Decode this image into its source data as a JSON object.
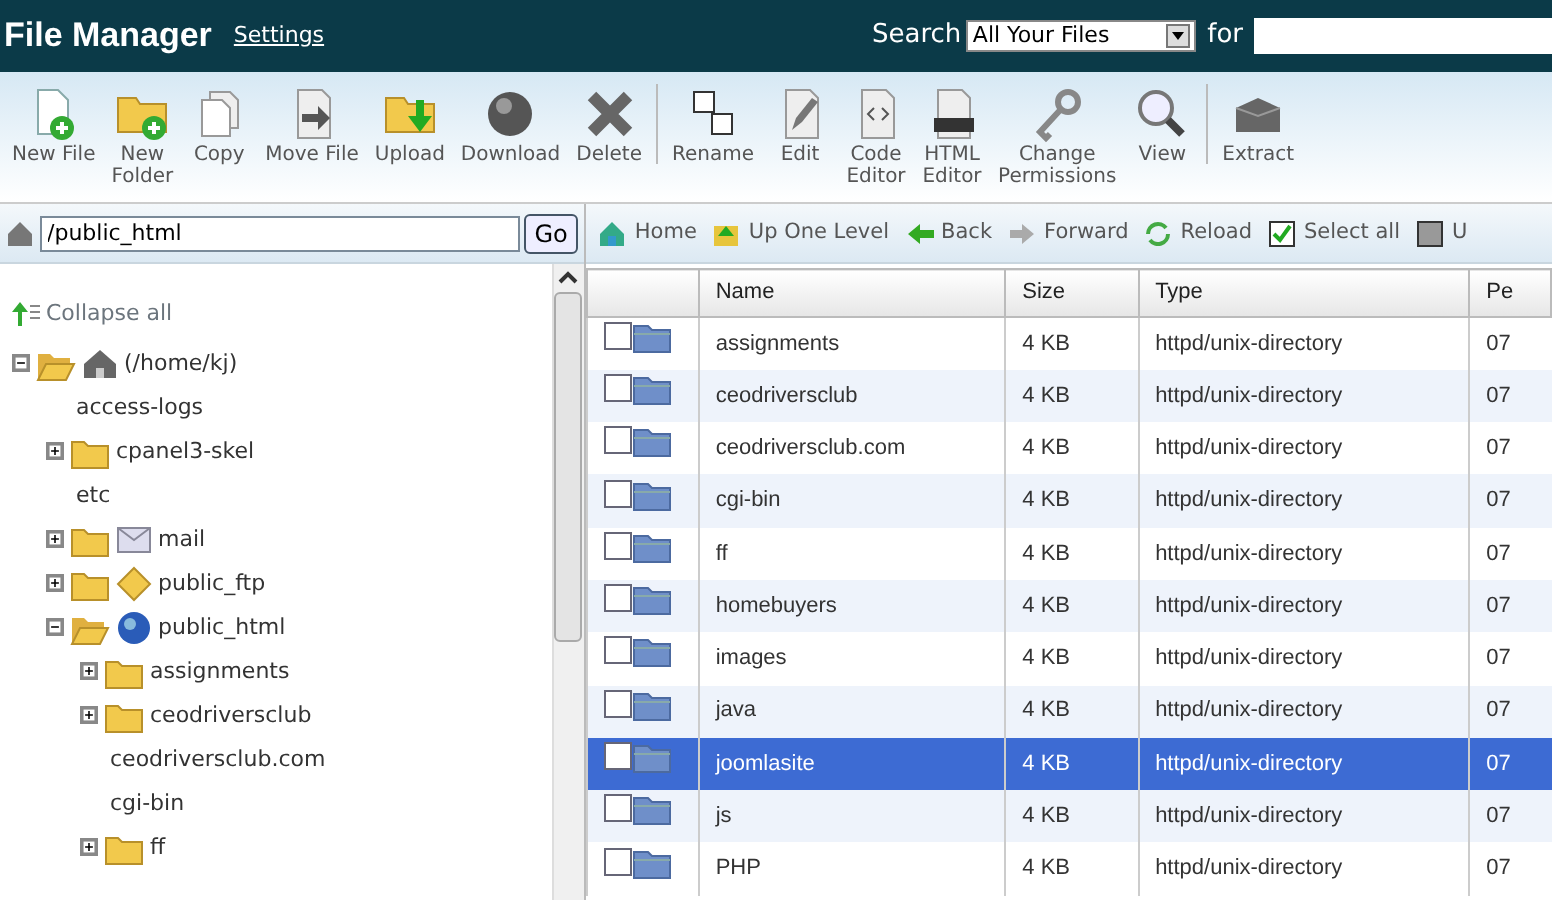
{
  "header": {
    "title": "File Manager",
    "settings_link": "Settings",
    "search_label": "Search",
    "search_scope": "All Your Files",
    "for_label": "for"
  },
  "toolbar": [
    [
      {
        "kind": "new-file",
        "lines": [
          "New File"
        ]
      },
      {
        "kind": "new-folder",
        "lines": [
          "New",
          "Folder"
        ]
      },
      {
        "kind": "copy",
        "lines": [
          "Copy"
        ]
      },
      {
        "kind": "move",
        "lines": [
          "Move File"
        ]
      },
      {
        "kind": "upload",
        "lines": [
          "Upload"
        ]
      },
      {
        "kind": "download",
        "lines": [
          "Download"
        ]
      },
      {
        "kind": "delete",
        "lines": [
          "Delete"
        ]
      }
    ],
    [
      {
        "kind": "rename",
        "lines": [
          "Rename"
        ]
      },
      {
        "kind": "edit",
        "lines": [
          "Edit"
        ]
      },
      {
        "kind": "code",
        "lines": [
          "Code",
          "Editor"
        ]
      },
      {
        "kind": "html",
        "lines": [
          "HTML",
          "Editor"
        ]
      },
      {
        "kind": "permissions",
        "lines": [
          "Change",
          "Permissions"
        ]
      },
      {
        "kind": "view",
        "lines": [
          "View"
        ]
      }
    ],
    [
      {
        "kind": "extract",
        "lines": [
          "Extract"
        ]
      }
    ]
  ],
  "path": {
    "value": "/public_html",
    "button": "Go"
  },
  "tree": {
    "collapse_all": "Collapse all",
    "items": [
      {
        "label": "(/home/kj)",
        "kind": "home",
        "expanded": true,
        "children": [
          {
            "label": "access-logs",
            "kind": "plain"
          },
          {
            "label": "cpanel3-skel",
            "kind": "folder",
            "expanded": false
          },
          {
            "label": "etc",
            "kind": "plain"
          },
          {
            "label": "mail",
            "kind": "mail",
            "expanded": false
          },
          {
            "label": "public_ftp",
            "kind": "ftp",
            "expanded": false
          },
          {
            "label": "public_html",
            "kind": "web",
            "expanded": true,
            "children": [
              {
                "label": "assignments",
                "kind": "folder",
                "expanded": false
              },
              {
                "label": "ceodriversclub",
                "kind": "folder",
                "expanded": false
              },
              {
                "label": "ceodriversclub.com",
                "kind": "plain"
              },
              {
                "label": "cgi-bin",
                "kind": "plain"
              },
              {
                "label": "ff",
                "kind": "folder",
                "expanded": false
              }
            ]
          }
        ]
      }
    ]
  },
  "nav": [
    {
      "kind": "home",
      "label": "Home"
    },
    {
      "kind": "up",
      "label": "Up One Level"
    },
    {
      "kind": "back",
      "label": "Back"
    },
    {
      "kind": "forward",
      "label": "Forward"
    },
    {
      "kind": "reload",
      "label": "Reload"
    },
    {
      "kind": "select",
      "label": "Select all"
    },
    {
      "kind": "unselect",
      "label": "U"
    }
  ],
  "table": {
    "columns": [
      "Name",
      "Size",
      "Type",
      "Pe"
    ],
    "rows": [
      {
        "name": "assignments",
        "size": "4 KB",
        "type": "httpd/unix-directory",
        "column_4": "07",
        "checked": false,
        "selected": false
      },
      {
        "name": "ceodriversclub",
        "size": "4 KB",
        "type": "httpd/unix-directory",
        "column_4": "07",
        "checked": false,
        "selected": false
      },
      {
        "name": "ceodriversclub.com",
        "size": "4 KB",
        "type": "httpd/unix-directory",
        "column_4": "07",
        "checked": false,
        "selected": false
      },
      {
        "name": "cgi-bin",
        "size": "4 KB",
        "type": "httpd/unix-directory",
        "column_4": "07",
        "checked": false,
        "selected": false
      },
      {
        "name": "ff",
        "size": "4 KB",
        "type": "httpd/unix-directory",
        "column_4": "07",
        "checked": false,
        "selected": false
      },
      {
        "name": "homebuyers",
        "size": "4 KB",
        "type": "httpd/unix-directory",
        "column_4": "07",
        "checked": false,
        "selected": false
      },
      {
        "name": "images",
        "size": "4 KB",
        "type": "httpd/unix-directory",
        "column_4": "07",
        "checked": false,
        "selected": false
      },
      {
        "name": "java",
        "size": "4 KB",
        "type": "httpd/unix-directory",
        "column_4": "07",
        "checked": false,
        "selected": false
      },
      {
        "name": "joomlasite",
        "size": "4 KB",
        "type": "httpd/unix-directory",
        "column_4": "07",
        "checked": false,
        "selected": true
      },
      {
        "name": "js",
        "size": "4 KB",
        "type": "httpd/unix-directory",
        "column_4": "07",
        "checked": false,
        "selected": false
      },
      {
        "name": "PHP",
        "size": "4 KB",
        "type": "httpd/unix-directory",
        "column_4": "07",
        "checked": false,
        "selected": false
      }
    ]
  }
}
